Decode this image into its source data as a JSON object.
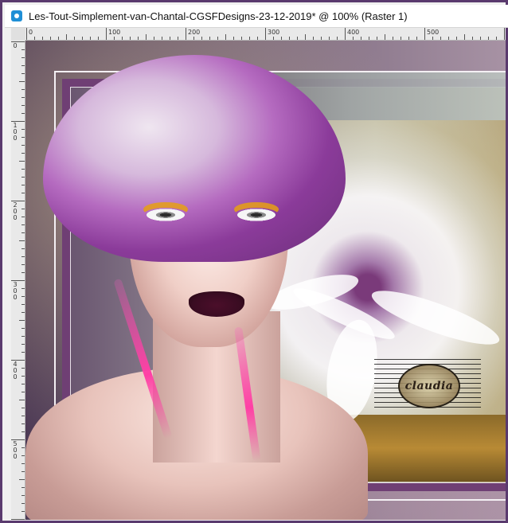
{
  "window": {
    "title": "Les-Tout-Simplement-van-Chantal-CGSFDesigns-23-12-2019* @ 100% (Raster 1)"
  },
  "rulers": {
    "horizontal_labels": [
      "0",
      "100",
      "200",
      "300",
      "400",
      "500"
    ],
    "vertical_labels": [
      "0",
      "100",
      "200",
      "300",
      "400",
      "500"
    ]
  },
  "canvas": {
    "watermark_text": "claudia"
  },
  "colors": {
    "window_border": "#5a3a6e",
    "frame_purple": "#6f3f74",
    "ruler_bg": "#e9e9e9",
    "accent_pink": "#ff3fa5",
    "accent_gold": "#b88a35"
  },
  "icons": {
    "app_icon": "app-icon"
  }
}
